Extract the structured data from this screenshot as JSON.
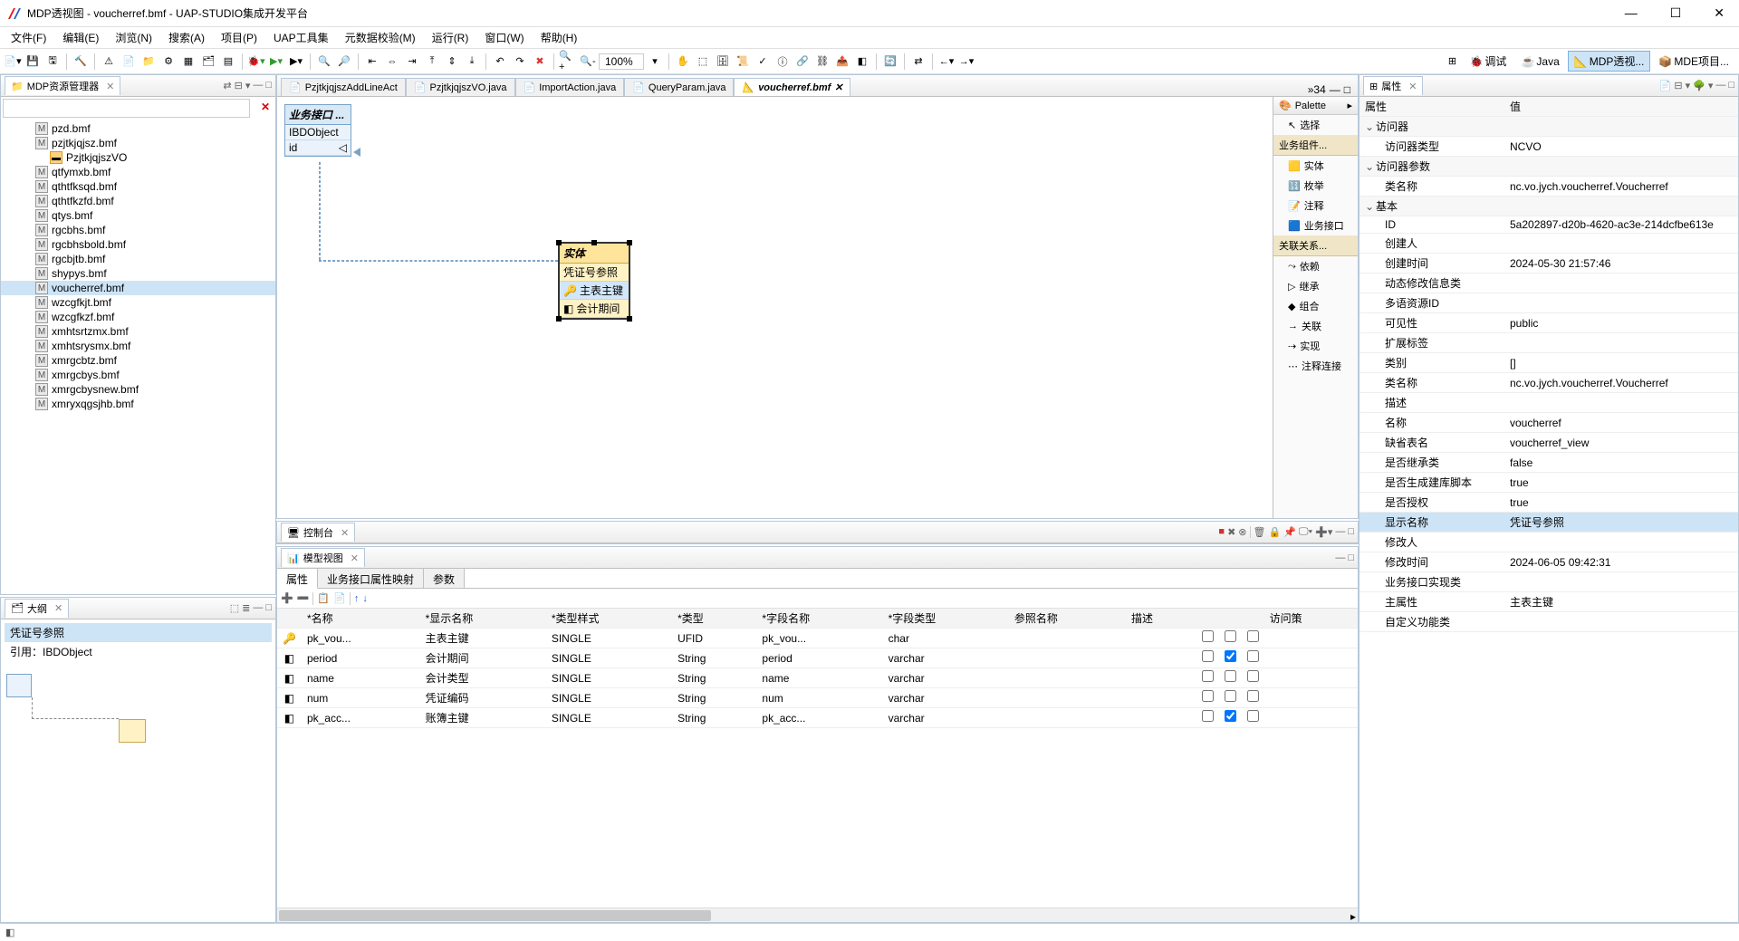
{
  "window": {
    "title": "MDP透视图 - voucherref.bmf - UAP-STUDIO集成开发平台"
  },
  "menu": [
    "文件(F)",
    "编辑(E)",
    "浏览(N)",
    "搜索(A)",
    "项目(P)",
    "UAP工具集",
    "元数据校验(M)",
    "运行(R)",
    "窗口(W)",
    "帮助(H)"
  ],
  "zoom": "100%",
  "perspectives": [
    {
      "label": "调试",
      "active": false
    },
    {
      "label": "Java",
      "active": false
    },
    {
      "label": "MDP透视...",
      "active": true
    },
    {
      "label": "MDE项目...",
      "active": false
    }
  ],
  "resource_manager": {
    "title": "MDP资源管理器",
    "items": [
      {
        "label": "pzd.bmf",
        "type": "m"
      },
      {
        "label": "pzjtkjqjsz.bmf",
        "type": "m"
      },
      {
        "label": "PzjtkjqjszVO",
        "type": "vo",
        "indent": true
      },
      {
        "label": "qtfymxb.bmf",
        "type": "m"
      },
      {
        "label": "qthtfksqd.bmf",
        "type": "m"
      },
      {
        "label": "qthtfkzfd.bmf",
        "type": "m"
      },
      {
        "label": "qtys.bmf",
        "type": "m"
      },
      {
        "label": "rgcbhs.bmf",
        "type": "m"
      },
      {
        "label": "rgcbhsbold.bmf",
        "type": "m"
      },
      {
        "label": "rgcbjtb.bmf",
        "type": "m"
      },
      {
        "label": "shypys.bmf",
        "type": "m"
      },
      {
        "label": "voucherref.bmf",
        "type": "m",
        "selected": true
      },
      {
        "label": "wzcgfkjt.bmf",
        "type": "m"
      },
      {
        "label": "wzcgfkzf.bmf",
        "type": "m"
      },
      {
        "label": "xmhtsrtzmx.bmf",
        "type": "m"
      },
      {
        "label": "xmhtsrysmx.bmf",
        "type": "m"
      },
      {
        "label": "xmrgcbtz.bmf",
        "type": "m"
      },
      {
        "label": "xmrgcbys.bmf",
        "type": "m"
      },
      {
        "label": "xmrgcbysnew.bmf",
        "type": "m"
      },
      {
        "label": "xmryxqgsjhb.bmf",
        "type": "m"
      }
    ]
  },
  "outline": {
    "title": "大纲",
    "items": [
      "凭证号参照",
      "引用：IBDObject"
    ]
  },
  "editor_tabs": [
    {
      "label": "PzjtkjqjszAddLineAct",
      "icon": "java"
    },
    {
      "label": "PzjtkjqjszVO.java",
      "icon": "java"
    },
    {
      "label": "ImportAction.java",
      "icon": "java"
    },
    {
      "label": "QueryParam.java",
      "icon": "java"
    },
    {
      "label": "voucherref.bmf",
      "icon": "bmf",
      "active": true
    }
  ],
  "editor_more": "»34",
  "canvas": {
    "iface": {
      "title": "业务接口 ...",
      "name": "IBDObject",
      "attr": "id"
    },
    "entity": {
      "title": "实体",
      "name": "凭证号参照",
      "attrs": [
        "主表主键",
        "会计期间"
      ]
    }
  },
  "palette": {
    "title": "Palette",
    "select": "选择",
    "sections": [
      {
        "title": "业务组件...",
        "items": [
          "实体",
          "枚举",
          "注释",
          "业务接口"
        ]
      },
      {
        "title": "关联关系...",
        "items": [
          "依赖",
          "继承",
          "组合",
          "关联",
          "实现",
          "注释连接"
        ]
      }
    ]
  },
  "console": {
    "title": "控制台"
  },
  "model_view": {
    "title": "模型视图",
    "tabs": [
      "属性",
      "业务接口属性映射",
      "参数"
    ],
    "columns": [
      "",
      "*名称",
      "*显示名称",
      "*类型样式",
      "*类型",
      "*字段名称",
      "*字段类型",
      "参照名称",
      "描述",
      "",
      "",
      "",
      "访问策"
    ],
    "rows": [
      {
        "icon": "key",
        "name": "pk_vou...",
        "disp": "主表主键",
        "style": "SINGLE",
        "type": "UFID",
        "field": "pk_vou...",
        "ftype": "char",
        "cb": [
          false,
          false,
          false
        ]
      },
      {
        "icon": "obj",
        "name": "period",
        "disp": "会计期间",
        "style": "SINGLE",
        "type": "String",
        "field": "period",
        "ftype": "varchar",
        "cb": [
          false,
          true,
          false
        ]
      },
      {
        "icon": "obj",
        "name": "name",
        "disp": "会计类型",
        "style": "SINGLE",
        "type": "String",
        "field": "name",
        "ftype": "varchar",
        "cb": [
          false,
          false,
          false
        ]
      },
      {
        "icon": "obj",
        "name": "num",
        "disp": "凭证编码",
        "style": "SINGLE",
        "type": "String",
        "field": "num",
        "ftype": "varchar",
        "cb": [
          false,
          false,
          false
        ]
      },
      {
        "icon": "obj",
        "name": "pk_acc...",
        "disp": "账簿主键",
        "style": "SINGLE",
        "type": "String",
        "field": "pk_acc...",
        "ftype": "varchar",
        "cb": [
          false,
          true,
          false
        ]
      }
    ]
  },
  "properties": {
    "title": "属性",
    "header": {
      "key": "属性",
      "val": "值"
    },
    "groups": [
      {
        "title": "访问器",
        "rows": [
          {
            "k": "访问器类型",
            "v": "NCVO"
          }
        ]
      },
      {
        "title": "访问器参数",
        "rows": [
          {
            "k": "类名称",
            "v": "nc.vo.jych.voucherref.Voucherref"
          }
        ]
      },
      {
        "title": "基本",
        "rows": [
          {
            "k": "ID",
            "v": "5a202897-d20b-4620-ac3e-214dcfbe613e"
          },
          {
            "k": "创建人",
            "v": ""
          },
          {
            "k": "创建时间",
            "v": "2024-05-30 21:57:46"
          },
          {
            "k": "动态修改信息类",
            "v": ""
          },
          {
            "k": "多语资源ID",
            "v": ""
          },
          {
            "k": "可见性",
            "v": "public"
          },
          {
            "k": "扩展标签",
            "v": ""
          },
          {
            "k": "类别",
            "v": "[]"
          },
          {
            "k": "类名称",
            "v": "nc.vo.jych.voucherref.Voucherref"
          },
          {
            "k": "描述",
            "v": ""
          },
          {
            "k": "名称",
            "v": "voucherref"
          },
          {
            "k": "缺省表名",
            "v": "voucherref_view"
          },
          {
            "k": "是否继承类",
            "v": "false"
          },
          {
            "k": "是否生成建库脚本",
            "v": "true"
          },
          {
            "k": "是否授权",
            "v": "true"
          },
          {
            "k": "显示名称",
            "v": "凭证号参照",
            "sel": true
          },
          {
            "k": "修改人",
            "v": ""
          },
          {
            "k": "修改时间",
            "v": "2024-06-05 09:42:31"
          },
          {
            "k": "业务接口实现类",
            "v": ""
          },
          {
            "k": "主属性",
            "v": "主表主键"
          },
          {
            "k": "自定义功能类",
            "v": ""
          }
        ]
      }
    ]
  }
}
